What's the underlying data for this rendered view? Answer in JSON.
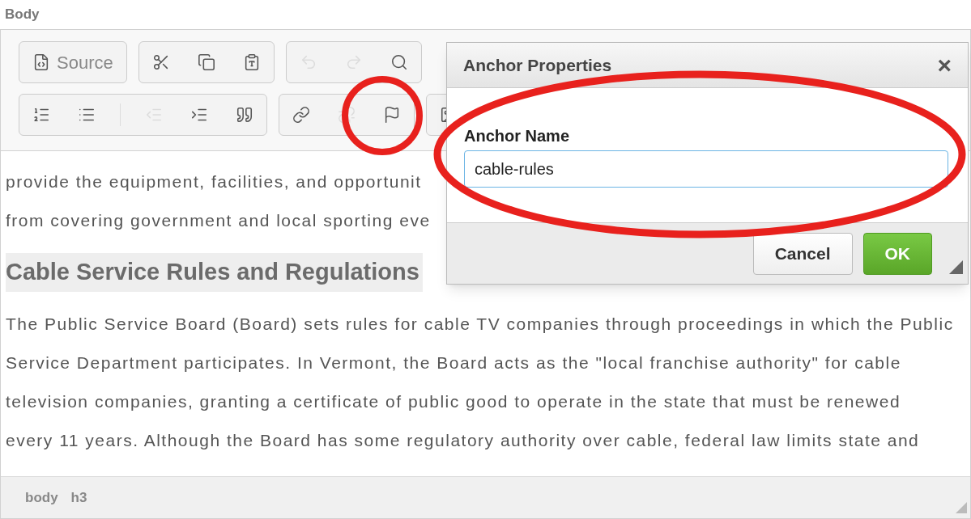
{
  "field_label": "Body",
  "toolbar": {
    "rows": [
      [
        {
          "items": [
            {
              "kind": "source",
              "label": "Source",
              "disabled": false
            }
          ]
        },
        {
          "items": [
            {
              "kind": "cut",
              "disabled": false
            },
            {
              "kind": "copy",
              "disabled": false
            },
            {
              "kind": "paste-text",
              "disabled": false
            }
          ]
        },
        {
          "items": [
            {
              "kind": "undo",
              "disabled": true
            },
            {
              "kind": "redo",
              "disabled": true
            },
            {
              "kind": "find",
              "disabled": false
            }
          ]
        }
      ],
      [
        {
          "items": [
            {
              "kind": "numbered-list",
              "disabled": false
            },
            {
              "kind": "bulleted-list",
              "disabled": false
            },
            {
              "kind": "separator"
            },
            {
              "kind": "outdent",
              "disabled": true
            },
            {
              "kind": "indent",
              "disabled": false
            },
            {
              "kind": "blockquote",
              "disabled": false
            }
          ]
        },
        {
          "items": [
            {
              "kind": "link",
              "disabled": false
            },
            {
              "kind": "unlink",
              "disabled": true
            },
            {
              "kind": "anchor",
              "disabled": false
            }
          ]
        },
        {
          "items": [
            {
              "kind": "image",
              "disabled": false
            }
          ]
        }
      ]
    ]
  },
  "content": [
    {
      "kind": "line",
      "text": "provide the equipment, facilities, and opportunit"
    },
    {
      "kind": "line",
      "text": "from covering government and local sporting eve"
    },
    {
      "kind": "heading",
      "text": "Cable Service Rules and Regulations"
    },
    {
      "kind": "line",
      "text": "The Public Service Board (Board) sets rules for cable TV companies through proceedings in which the Public"
    },
    {
      "kind": "line",
      "text": "Service Department participates. In Vermont, the Board acts as the \"local franchise authority\" for cable"
    },
    {
      "kind": "line",
      "text": "television companies, granting a certificate of public good to operate in the state that must be renewed"
    },
    {
      "kind": "line",
      "text": "every 11 years. Although the Board has some regulatory authority over cable, federal law limits state and"
    }
  ],
  "status_bar": {
    "path": [
      "body",
      "h3"
    ]
  },
  "dialog": {
    "title": "Anchor Properties",
    "close": "×",
    "field_label": "Anchor Name",
    "value": "cable-rules",
    "buttons": [
      {
        "kind": "secondary",
        "label": "Cancel"
      },
      {
        "kind": "primary",
        "label": "OK"
      }
    ]
  }
}
